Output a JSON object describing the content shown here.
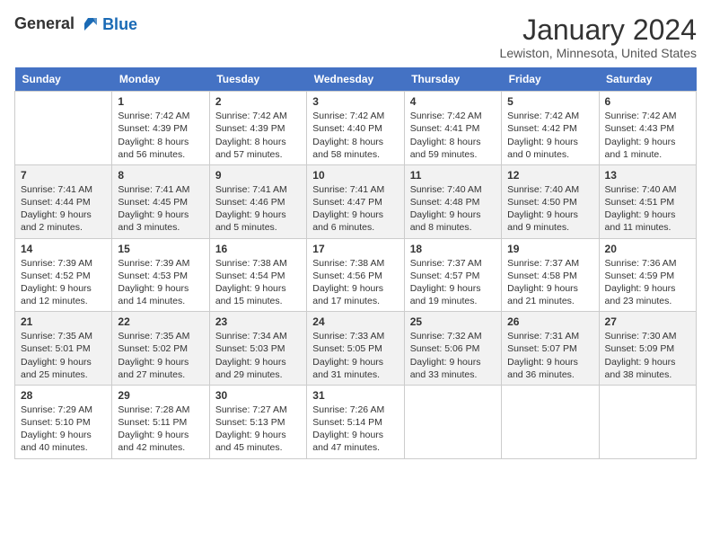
{
  "header": {
    "logo_line1": "General",
    "logo_line2": "Blue",
    "month": "January 2024",
    "location": "Lewiston, Minnesota, United States"
  },
  "days_of_week": [
    "Sunday",
    "Monday",
    "Tuesday",
    "Wednesday",
    "Thursday",
    "Friday",
    "Saturday"
  ],
  "weeks": [
    [
      {
        "day": "",
        "info": ""
      },
      {
        "day": "1",
        "info": "Sunrise: 7:42 AM\nSunset: 4:39 PM\nDaylight: 8 hours\nand 56 minutes."
      },
      {
        "day": "2",
        "info": "Sunrise: 7:42 AM\nSunset: 4:39 PM\nDaylight: 8 hours\nand 57 minutes."
      },
      {
        "day": "3",
        "info": "Sunrise: 7:42 AM\nSunset: 4:40 PM\nDaylight: 8 hours\nand 58 minutes."
      },
      {
        "day": "4",
        "info": "Sunrise: 7:42 AM\nSunset: 4:41 PM\nDaylight: 8 hours\nand 59 minutes."
      },
      {
        "day": "5",
        "info": "Sunrise: 7:42 AM\nSunset: 4:42 PM\nDaylight: 9 hours\nand 0 minutes."
      },
      {
        "day": "6",
        "info": "Sunrise: 7:42 AM\nSunset: 4:43 PM\nDaylight: 9 hours\nand 1 minute."
      }
    ],
    [
      {
        "day": "7",
        "info": "Sunrise: 7:41 AM\nSunset: 4:44 PM\nDaylight: 9 hours\nand 2 minutes."
      },
      {
        "day": "8",
        "info": "Sunrise: 7:41 AM\nSunset: 4:45 PM\nDaylight: 9 hours\nand 3 minutes."
      },
      {
        "day": "9",
        "info": "Sunrise: 7:41 AM\nSunset: 4:46 PM\nDaylight: 9 hours\nand 5 minutes."
      },
      {
        "day": "10",
        "info": "Sunrise: 7:41 AM\nSunset: 4:47 PM\nDaylight: 9 hours\nand 6 minutes."
      },
      {
        "day": "11",
        "info": "Sunrise: 7:40 AM\nSunset: 4:48 PM\nDaylight: 9 hours\nand 8 minutes."
      },
      {
        "day": "12",
        "info": "Sunrise: 7:40 AM\nSunset: 4:50 PM\nDaylight: 9 hours\nand 9 minutes."
      },
      {
        "day": "13",
        "info": "Sunrise: 7:40 AM\nSunset: 4:51 PM\nDaylight: 9 hours\nand 11 minutes."
      }
    ],
    [
      {
        "day": "14",
        "info": "Sunrise: 7:39 AM\nSunset: 4:52 PM\nDaylight: 9 hours\nand 12 minutes."
      },
      {
        "day": "15",
        "info": "Sunrise: 7:39 AM\nSunset: 4:53 PM\nDaylight: 9 hours\nand 14 minutes."
      },
      {
        "day": "16",
        "info": "Sunrise: 7:38 AM\nSunset: 4:54 PM\nDaylight: 9 hours\nand 15 minutes."
      },
      {
        "day": "17",
        "info": "Sunrise: 7:38 AM\nSunset: 4:56 PM\nDaylight: 9 hours\nand 17 minutes."
      },
      {
        "day": "18",
        "info": "Sunrise: 7:37 AM\nSunset: 4:57 PM\nDaylight: 9 hours\nand 19 minutes."
      },
      {
        "day": "19",
        "info": "Sunrise: 7:37 AM\nSunset: 4:58 PM\nDaylight: 9 hours\nand 21 minutes."
      },
      {
        "day": "20",
        "info": "Sunrise: 7:36 AM\nSunset: 4:59 PM\nDaylight: 9 hours\nand 23 minutes."
      }
    ],
    [
      {
        "day": "21",
        "info": "Sunrise: 7:35 AM\nSunset: 5:01 PM\nDaylight: 9 hours\nand 25 minutes."
      },
      {
        "day": "22",
        "info": "Sunrise: 7:35 AM\nSunset: 5:02 PM\nDaylight: 9 hours\nand 27 minutes."
      },
      {
        "day": "23",
        "info": "Sunrise: 7:34 AM\nSunset: 5:03 PM\nDaylight: 9 hours\nand 29 minutes."
      },
      {
        "day": "24",
        "info": "Sunrise: 7:33 AM\nSunset: 5:05 PM\nDaylight: 9 hours\nand 31 minutes."
      },
      {
        "day": "25",
        "info": "Sunrise: 7:32 AM\nSunset: 5:06 PM\nDaylight: 9 hours\nand 33 minutes."
      },
      {
        "day": "26",
        "info": "Sunrise: 7:31 AM\nSunset: 5:07 PM\nDaylight: 9 hours\nand 36 minutes."
      },
      {
        "day": "27",
        "info": "Sunrise: 7:30 AM\nSunset: 5:09 PM\nDaylight: 9 hours\nand 38 minutes."
      }
    ],
    [
      {
        "day": "28",
        "info": "Sunrise: 7:29 AM\nSunset: 5:10 PM\nDaylight: 9 hours\nand 40 minutes."
      },
      {
        "day": "29",
        "info": "Sunrise: 7:28 AM\nSunset: 5:11 PM\nDaylight: 9 hours\nand 42 minutes."
      },
      {
        "day": "30",
        "info": "Sunrise: 7:27 AM\nSunset: 5:13 PM\nDaylight: 9 hours\nand 45 minutes."
      },
      {
        "day": "31",
        "info": "Sunrise: 7:26 AM\nSunset: 5:14 PM\nDaylight: 9 hours\nand 47 minutes."
      },
      {
        "day": "",
        "info": ""
      },
      {
        "day": "",
        "info": ""
      },
      {
        "day": "",
        "info": ""
      }
    ]
  ]
}
